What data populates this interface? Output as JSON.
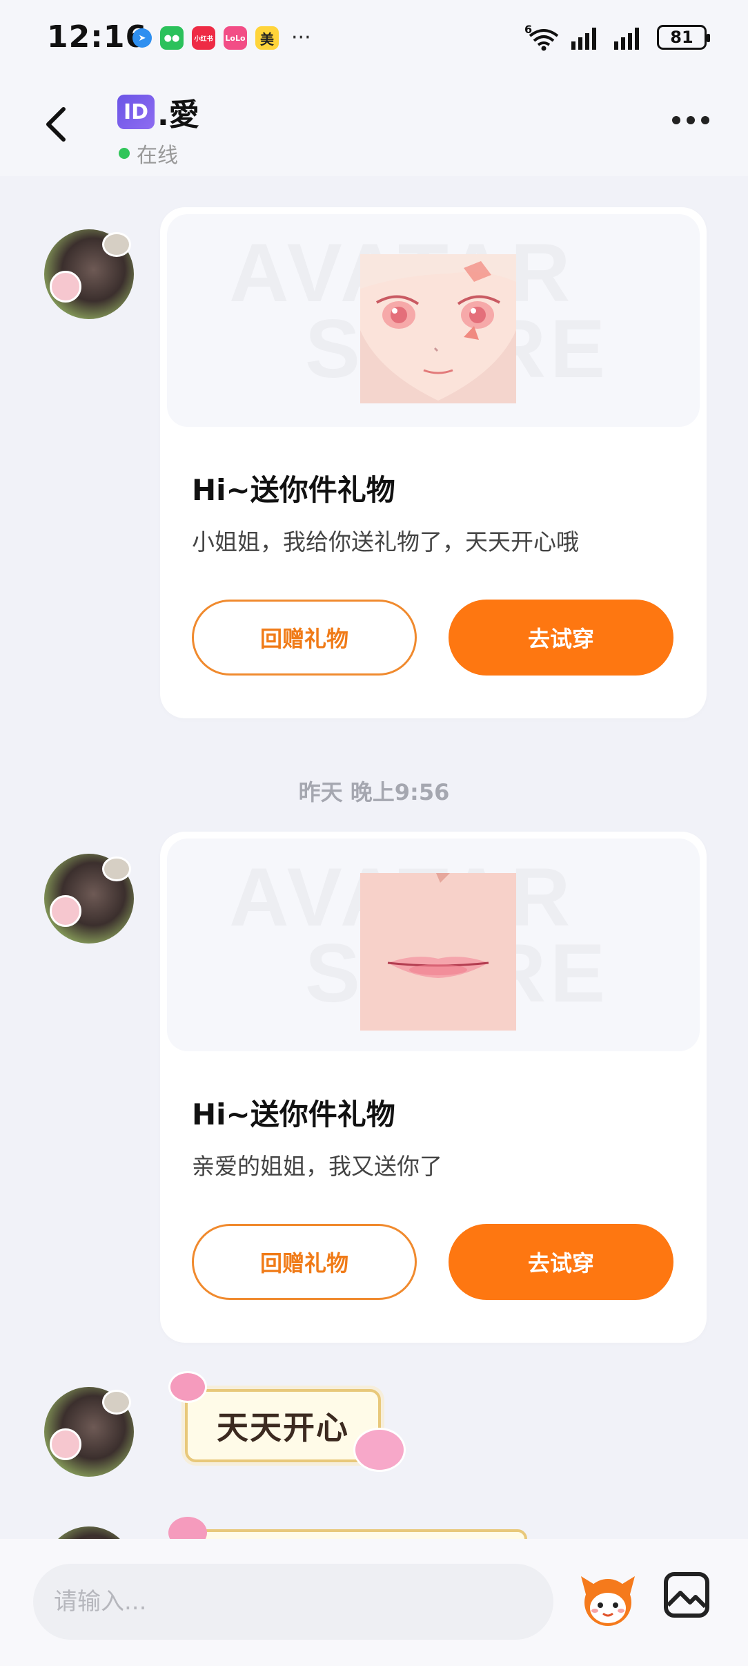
{
  "status_bar": {
    "time": "12:16",
    "notifications": [
      "小红书",
      "LoLo",
      "美"
    ],
    "more": "···",
    "network": "6",
    "battery": "81"
  },
  "header": {
    "id_badge": "ID",
    "name": ".愛",
    "status": "在线"
  },
  "messages": [
    {
      "type": "gift",
      "title": "Hi~送你件礼物",
      "text": "小姐姐，我给你送礼物了，天天开心哦",
      "return_label": "回赠礼物",
      "try_label": "去试穿",
      "watermark_1": "AVATAR",
      "watermark_2": "STORE"
    },
    {
      "type": "time",
      "text": "昨天 晚上9:56"
    },
    {
      "type": "gift",
      "title": "Hi~送你件礼物",
      "text": "亲爱的姐姐，我又送你了",
      "return_label": "回赠礼物",
      "try_label": "去试穿",
      "watermark_1": "AVATAR",
      "watermark_2": "STORE"
    },
    {
      "type": "sticker",
      "text": "天天开心"
    }
  ],
  "input": {
    "placeholder": "请输入..."
  },
  "colors": {
    "accent": "#fe7711",
    "online": "#31c55a",
    "background": "#f1f2f8"
  }
}
